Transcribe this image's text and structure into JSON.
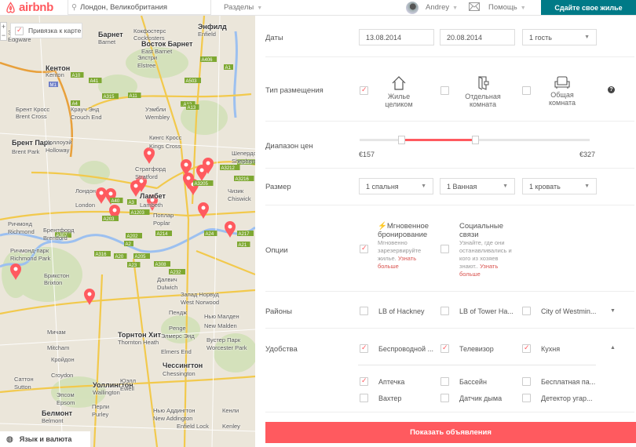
{
  "header": {
    "logo": "airbnb",
    "search_value": "Лондон, Великобритания",
    "sections": "Разделы",
    "user": "Andrey",
    "help": "Помощь",
    "host_button": "Сдайте свое жилье"
  },
  "map": {
    "snap_to_map": "Привязка к карте",
    "snap_checked": true,
    "zoom_in": "+",
    "zoom_out": "−",
    "language_currency": "Язык и валюта",
    "labels": [
      "Энфилд",
      "Enfield",
      "Барнет",
      "Barnet",
      "Кокфостерс",
      "Cockfosters",
      "Восток Барнет",
      "East Barnet",
      "Элстри",
      "Elstree",
      "Эджвар",
      "Edgware",
      "Кентон",
      "Kenton",
      "Брент Кросс",
      "Brent Cross",
      "Крауч Энд",
      "Crouch End",
      "Уэмбли",
      "Wembley",
      "Брент Парк",
      "Brent Park",
      "Холлоуэй",
      "Holloway",
      "Кингс Кросс",
      "Kings Cross",
      "Стратфорд",
      "Stratford",
      "Шепердс Буш",
      "Shepherd's Bush",
      "Лондон",
      "London",
      "Ламбет",
      "Lambeth",
      "Поплар",
      "Poplar",
      "Чизик",
      "Chiswick",
      "Брентфорд",
      "Brentford",
      "Ричмонд",
      "Richmond",
      "Ричмонд-парк",
      "Richmond Park",
      "Брикстон",
      "Brixton",
      "Далвич",
      "Dulwich",
      "Запад Норвуд",
      "West Norwood",
      "Пендж",
      "Penge",
      "Нью Малден",
      "New Malden",
      "Мичам",
      "Mitcham",
      "Торнтон Хит",
      "Thornton Heath",
      "Элмерс Энд",
      "Elmers End",
      "Вустер Парк",
      "Worcester Park",
      "Кройдон",
      "Croydon",
      "Чессингтон",
      "Chessington",
      "Саттон",
      "Sutton",
      "Уоллингтон",
      "Wallington",
      "Юэлл",
      "Ewell",
      "Эпсом",
      "Epsom",
      "Белмонт",
      "Belmont",
      "Перли",
      "Purley",
      "Нью Аддингтон",
      "New Addington",
      "Кенли",
      "Kenley",
      "Enfield Lock"
    ],
    "road_shields": [
      "M1",
      "A10",
      "A406",
      "A1",
      "A41",
      "A503",
      "A5",
      "A315",
      "A4",
      "A11",
      "A12",
      "A1203",
      "A13",
      "A40",
      "A3212",
      "A3220",
      "A3205",
      "A3216",
      "A3",
      "A203",
      "A202",
      "A2",
      "A20",
      "A205",
      "A23",
      "A214",
      "A24",
      "A217",
      "A21",
      "A232",
      "A308",
      "A316",
      "A307"
    ],
    "pin_color": "#ff5a5f"
  },
  "filters": {
    "dates": {
      "label": "Даты",
      "checkin": "13.08.2014",
      "checkout": "20.08.2014",
      "guests": "1 гость"
    },
    "room_type": {
      "label": "Тип размещения",
      "options": [
        {
          "label1": "Жилье",
          "label2": "целиком",
          "checked": true,
          "icon": "house-icon"
        },
        {
          "label1": "Отдельная",
          "label2": "комната",
          "checked": false,
          "icon": "private-room-door-icon"
        },
        {
          "label1": "Общая",
          "label2": "комната",
          "checked": false,
          "icon": "sofa-icon"
        }
      ],
      "help": "?"
    },
    "price": {
      "label": "Диапазон цен",
      "min": "€157",
      "max": "€327",
      "range_low_fraction": 0.18,
      "range_high_fraction": 0.5
    },
    "size": {
      "label": "Размер",
      "bedrooms": "1 спальня",
      "bathrooms": "1 Ванная",
      "beds": "1 кровать"
    },
    "options": {
      "label": "Опции",
      "instant": {
        "title": "Мгновенное бронирование",
        "desc": "Мгновенно зарезервируйте жилье.",
        "more": "Узнать больше",
        "checked": true
      },
      "social": {
        "title": "Социальные связи",
        "desc": "Узнайте, где они останавливались и кого из хозяев знают..",
        "more": "Узнать больше",
        "checked": false
      }
    },
    "neighborhoods": {
      "label": "Районы",
      "items": [
        {
          "label": "LB of Hackney",
          "checked": false
        },
        {
          "label": "LB of Tower Ha...",
          "checked": false
        },
        {
          "label": "City of Westmin...",
          "checked": false
        }
      ]
    },
    "amenities": {
      "label": "Удобства",
      "top": [
        {
          "label": "Беспроводной ...",
          "checked": true
        },
        {
          "label": "Телевизор",
          "checked": true
        },
        {
          "label": "Кухня",
          "checked": true
        }
      ],
      "more": [
        {
          "label": "Аптечка",
          "checked": true
        },
        {
          "label": "Бассейн",
          "checked": false
        },
        {
          "label": "Бесплатная па...",
          "checked": false
        },
        {
          "label": "Вахтер",
          "checked": false
        },
        {
          "label": "Датчик дыма",
          "checked": false
        },
        {
          "label": "Детектор угар...",
          "checked": false
        }
      ]
    }
  },
  "show_listings": "Показать объявления",
  "colors": {
    "accent": "#ff5a5f",
    "host_button": "#007a87"
  }
}
